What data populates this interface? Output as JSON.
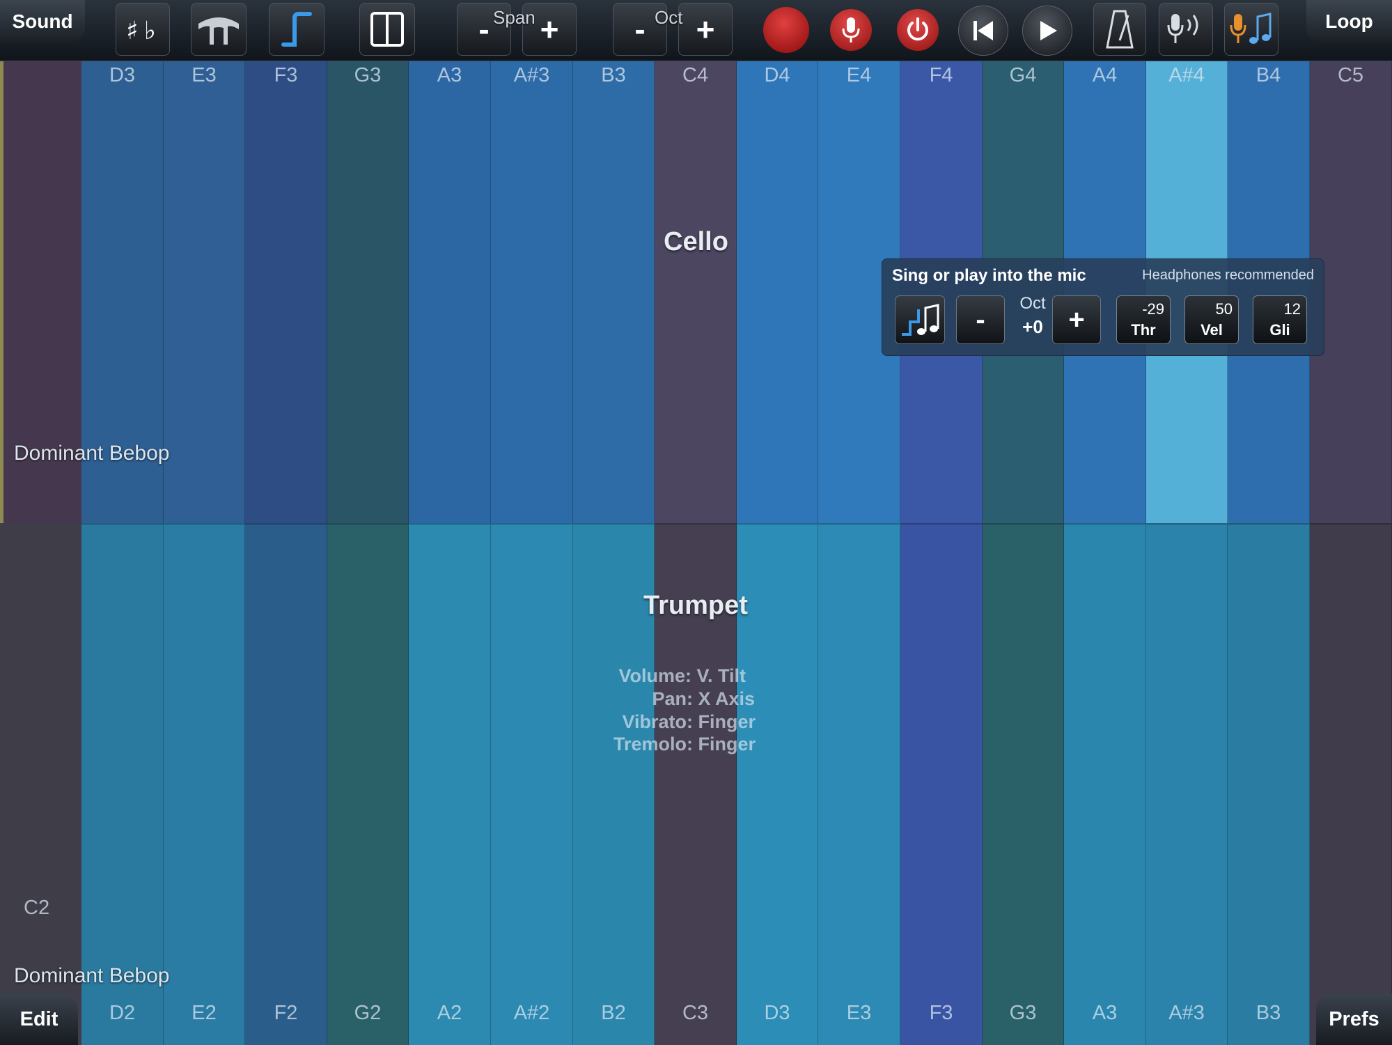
{
  "toolbar": {
    "sound_label": "Sound",
    "loop_label": "Loop",
    "span_label": "Span",
    "oct_label": "Oct",
    "minus": "-",
    "plus": "+",
    "sharp_flat_icon": "sharp-flat-icon",
    "icons": [
      "sharp-flat-icon",
      "legato-icon",
      "glide-icon",
      "split-icon",
      "record-icon",
      "mic-icon",
      "power-icon",
      "rewind-icon",
      "play-icon",
      "metronome-icon",
      "mic-sound-icon",
      "mic-note-icon"
    ]
  },
  "columns": {
    "top_notes": [
      "D3",
      "E3",
      "F3",
      "G3",
      "A3",
      "A#3",
      "B3",
      "C4",
      "D4",
      "E4",
      "F4",
      "G4",
      "A4",
      "A#4",
      "B4",
      "C5"
    ],
    "bottom_notes": [
      "D2",
      "E2",
      "F2",
      "G2",
      "A2",
      "A#2",
      "B2",
      "C3",
      "D3",
      "E3",
      "F3",
      "G3",
      "A3",
      "A#3",
      "B3",
      ""
    ],
    "left_bottom_note": "C2",
    "colors_top": [
      "#2e5f92",
      "#2f5f94",
      "#2e4d85",
      "#2a5566",
      "#2c67a4",
      "#2d6aa8",
      "#2d6ca6",
      "#4c4660",
      "#2f76b8",
      "#3079bb",
      "#3a58a6",
      "#2a5e70",
      "#2f73b4",
      "#55b0d8",
      "#2f6eae",
      "#46405a"
    ],
    "colors_bottom": [
      "#2a7aa0",
      "#2b7ca5",
      "#2b5d8a",
      "#2a6068",
      "#2c89b0",
      "#2c89b2",
      "#2b86ab",
      "#463f52",
      "#2c8db6",
      "#2c8ab4",
      "#3a54a4",
      "#2a6068",
      "#2b86ae",
      "#2b82aa",
      "#2b7ca2",
      "#403c4c"
    ],
    "highlight_top_index": 13
  },
  "instruments": {
    "top_name": "Cello",
    "bottom_name": "Trumpet",
    "top_scale": "Dominant Bebop",
    "bottom_scale": "Dominant Bebop",
    "controls": [
      "Volume: V. Tilt",
      "Pan: X Axis",
      "Vibrato: Finger",
      "Tremolo: Finger"
    ]
  },
  "mic_panel": {
    "title": "Sing or play into the mic",
    "hint": "Headphones recommended",
    "oct_label": "Oct",
    "oct_value": "+0",
    "minus": "-",
    "plus": "+",
    "threshold": {
      "value": "-29",
      "label": "Thr"
    },
    "velocity": {
      "value": "50",
      "label": "Vel"
    },
    "glide": {
      "value": "12",
      "label": "Gli"
    }
  },
  "bottom": {
    "edit_label": "Edit",
    "prefs_label": "Prefs"
  }
}
